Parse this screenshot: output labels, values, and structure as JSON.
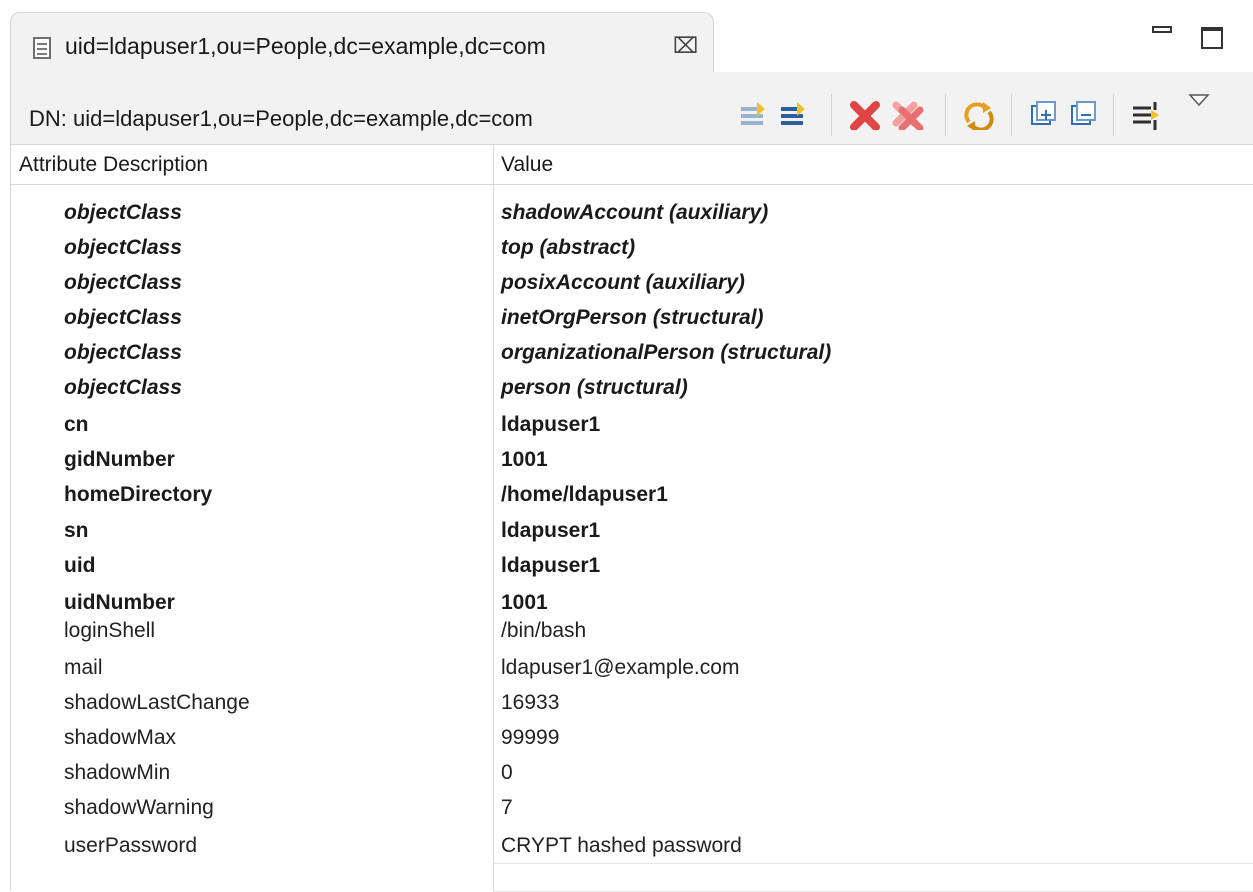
{
  "tab": {
    "title": "uid=ldapuser1,ou=People,dc=example,dc=com",
    "close_icon": "⌧"
  },
  "dn": {
    "label": "DN: uid=ldapuser1,ou=People,dc=example,dc=com"
  },
  "toolbar": {
    "icons": [
      "new-value-icon",
      "new-attribute-icon",
      "delete-value-icon",
      "delete-all-values-icon",
      "refresh-icon",
      "expand-all-icon",
      "collapse-all-icon",
      "toggle-quickfilter-icon",
      "view-menu-icon"
    ]
  },
  "table": {
    "headers": {
      "attribute": "Attribute Description",
      "value": "Value"
    },
    "rows": [
      {
        "attribute": "objectClass",
        "value": "shadowAccount (auxiliary)",
        "kind": "oc"
      },
      {
        "attribute": "objectClass",
        "value": "top (abstract)",
        "kind": "oc"
      },
      {
        "attribute": "objectClass",
        "value": "posixAccount (auxiliary)",
        "kind": "oc"
      },
      {
        "attribute": "objectClass",
        "value": "inetOrgPerson (structural)",
        "kind": "oc"
      },
      {
        "attribute": "objectClass",
        "value": "organizationalPerson (structural)",
        "kind": "oc"
      },
      {
        "attribute": "objectClass",
        "value": "person (structural)",
        "kind": "oc"
      },
      {
        "attribute": "cn",
        "value": "ldapuser1",
        "kind": "must"
      },
      {
        "attribute": "gidNumber",
        "value": "1001",
        "kind": "must"
      },
      {
        "attribute": "homeDirectory",
        "value": "/home/ldapuser1",
        "kind": "must"
      },
      {
        "attribute": "sn",
        "value": "ldapuser1",
        "kind": "must"
      },
      {
        "attribute": "uid",
        "value": "ldapuser1",
        "kind": "must"
      },
      {
        "attribute": "uidNumber",
        "value": "1001",
        "kind": "must"
      },
      {
        "attribute": "loginShell",
        "value": "/bin/bash",
        "kind": "may"
      },
      {
        "attribute": "mail",
        "value": "ldapuser1@example.com",
        "kind": "may"
      },
      {
        "attribute": "shadowLastChange",
        "value": "16933",
        "kind": "may"
      },
      {
        "attribute": "shadowMax",
        "value": "99999",
        "kind": "may"
      },
      {
        "attribute": "shadowMin",
        "value": "0",
        "kind": "may"
      },
      {
        "attribute": "shadowWarning",
        "value": "7",
        "kind": "may"
      },
      {
        "attribute": "userPassword",
        "value": "CRYPT hashed password",
        "kind": "may"
      }
    ]
  },
  "colors": {
    "panel_bg": "#f2f2f2",
    "delete_red": "#e04040",
    "refresh_orange": "#e8a020",
    "nav_blue": "#2f6fb5"
  }
}
